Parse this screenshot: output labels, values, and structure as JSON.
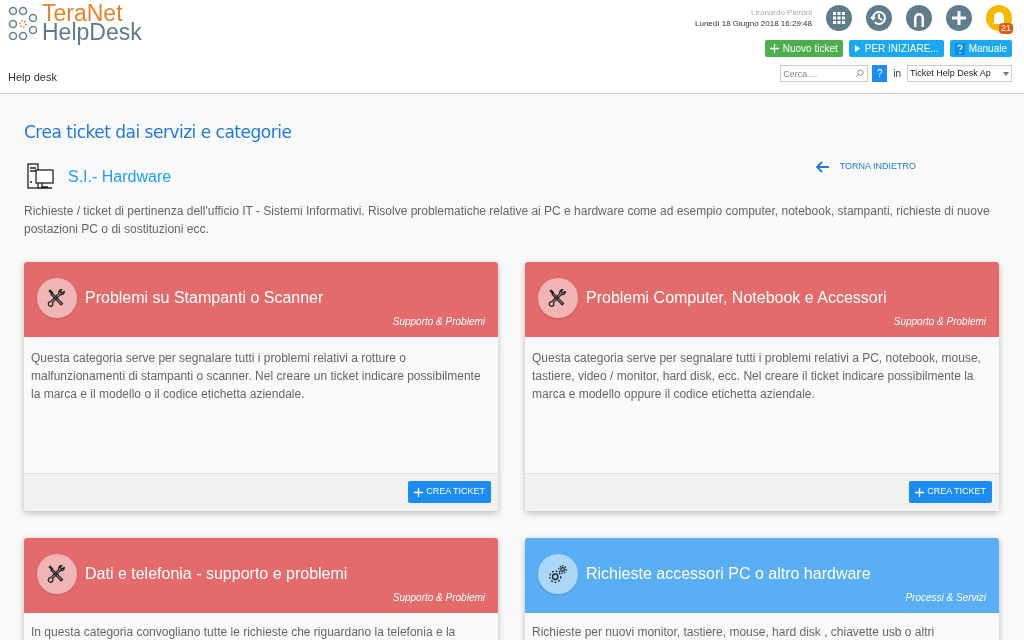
{
  "logo": {
    "line1": "TeraNet",
    "line2": "HelpDesk"
  },
  "user": {
    "name": "Leonardo Pieroni",
    "datetime": "Lunedì 18 Giugno 2018 16:29:48"
  },
  "notifications": {
    "count": "21"
  },
  "actions": [
    {
      "label": "Nuovo ticket",
      "kind": "new"
    },
    {
      "label": "PER INIZIARE...",
      "kind": "start"
    },
    {
      "label": "Manuale",
      "kind": "manual"
    }
  ],
  "search": {
    "placeholder": "Cerca ...",
    "help": "?",
    "in_label": "in",
    "scope": "Ticket Help Desk Ap"
  },
  "breadcrumb": "Help desk",
  "page": {
    "title": "Crea ticket dai servizi e categorie",
    "back": "TORNA INDIETRO",
    "service": "S.I.- Hardware",
    "description": "Richieste / ticket di pertinenza dell'ufficio IT - Sistemi Informativi. Risolve problematiche relative ai PC e hardware come ad esempio computer, notebook, stampanti, richieste di nuove postazioni PC o di sostituzioni ecc."
  },
  "cards": [
    {
      "title": "Problemi su Stampanti o Scanner",
      "type": "Supporto & Problemi",
      "color": "#e36b6b",
      "kind": "tools",
      "text": "Questa categoria serve per segnalare tutti i problemi relativi a rotture o malfunzionamenti di stampanti o scanner. Nel creare un ticket indicare possibilmente la marca e il modello o il codice etichetta aziendale.",
      "button": "CREA TICKET"
    },
    {
      "title": "Problemi Computer, Notebook e Accessori",
      "type": "Supporto & Problemi",
      "color": "#e36b6b",
      "kind": "tools",
      "text": "Questa categoria serve per segnalare tutti i problemi relativi a PC, notebook, mouse, tastiere, video / monitor, hard disk, ecc. Nel creare il ticket indicare possibilmente la marca e modello oppure il codice etichetta aziendale.",
      "button": "CREA TICKET"
    },
    {
      "title": "Dati e telefonia - supporto e problemi",
      "type": "Supporto & Problemi",
      "color": "#e36b6b",
      "kind": "tools",
      "text": "In questa categoria convogliano tutte le richieste che riguardano la telefonia e la"
    },
    {
      "title": "Richieste accessori PC o altro hardware",
      "type": "Processi & Servizi",
      "color": "#5aaef3",
      "kind": "gears",
      "text": "Richieste per nuovi monitor, tastiere, mouse, hard disk , chiavette usb o altri"
    }
  ]
}
